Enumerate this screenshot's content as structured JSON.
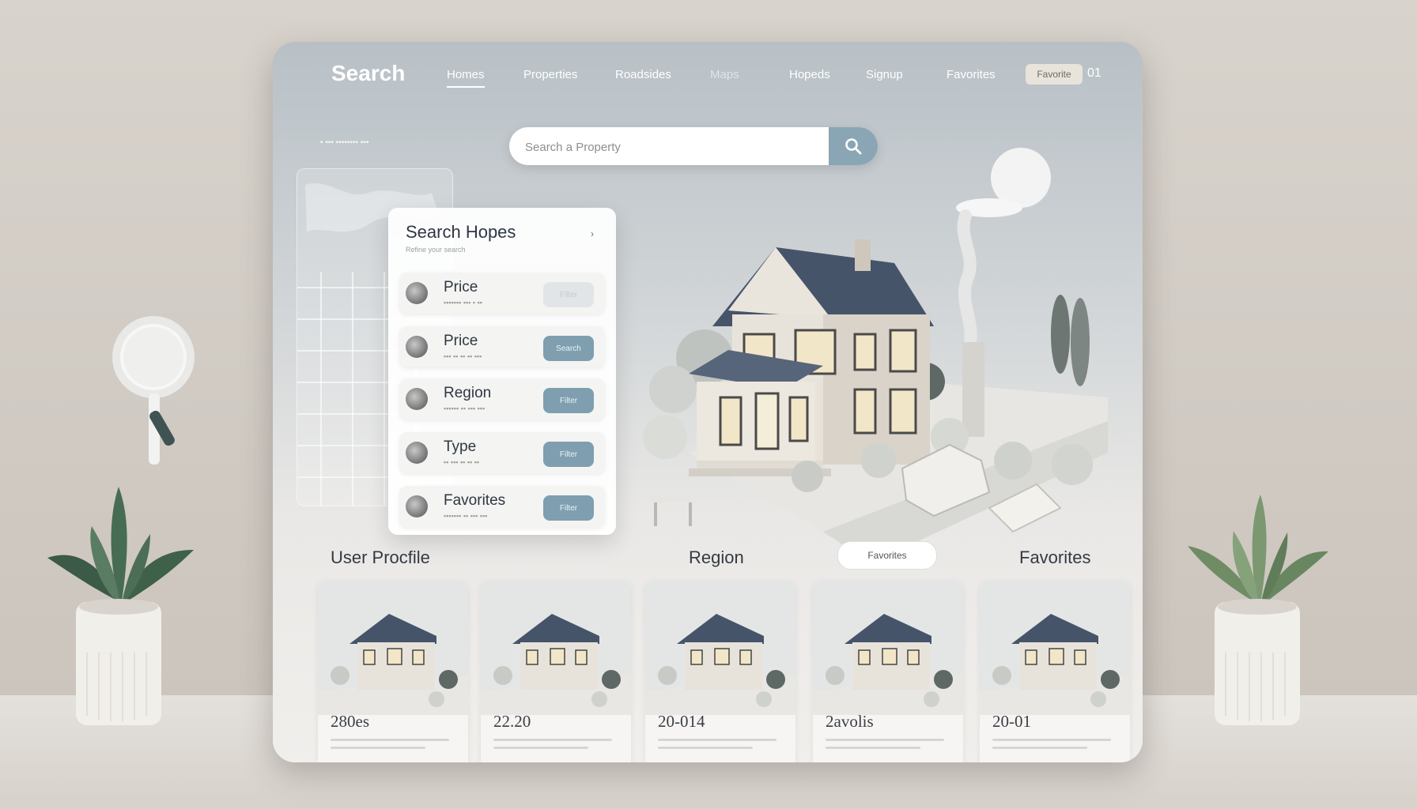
{
  "nav": {
    "brand": "Search",
    "items": [
      "Homes",
      "Properties",
      "Roadsides",
      "Maps",
      "Hopeds",
      "Signup",
      "Favorites"
    ],
    "pill_label": "Favorite",
    "tail": "01"
  },
  "search": {
    "placeholder": "Search a Property"
  },
  "filter": {
    "title": "Search Hopes",
    "subtitle": "Refine your search",
    "rows": [
      {
        "label": "Price",
        "button": "Filter"
      },
      {
        "label": "Price",
        "button": "Search"
      },
      {
        "label": "Region",
        "button": "Filter"
      },
      {
        "label": "Type",
        "button": "Filter"
      },
      {
        "label": "Favorites",
        "button": "Filter"
      }
    ]
  },
  "sections": {
    "user_profile": "User Procfile",
    "region": "Region",
    "chip": "Favorites",
    "favorites": "Favorites"
  },
  "listings": [
    {
      "price": "280es"
    },
    {
      "price": "22.20"
    },
    {
      "price": "20-014"
    },
    {
      "price": "2avolis"
    },
    {
      "price": "20-01"
    }
  ],
  "colors": {
    "accent": "#7f9fb0",
    "text": "#2f3742",
    "panel_top": "#b8c0c6"
  }
}
